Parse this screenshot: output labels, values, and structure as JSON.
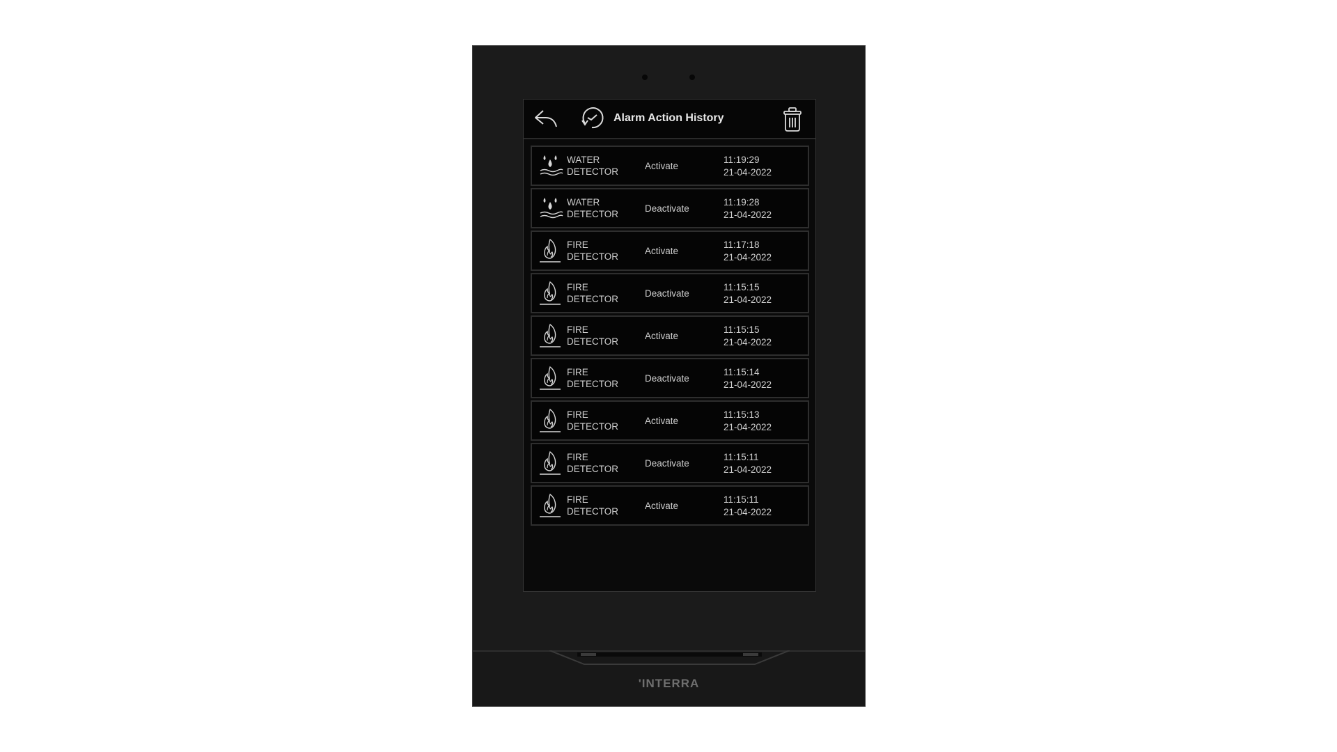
{
  "device": {
    "brand_logo": "'INTERRA"
  },
  "header": {
    "back_icon": "back-arrow-icon",
    "history_icon": "history-clock-icon",
    "title": "Alarm Action History",
    "delete_icon": "trash-icon"
  },
  "rows": [
    {
      "icon": "water-detector-icon",
      "device": "WATER DETECTOR",
      "action": "Activate",
      "time": "11:19:29",
      "date": "21-04-2022"
    },
    {
      "icon": "water-detector-icon",
      "device": "WATER DETECTOR",
      "action": "Deactivate",
      "time": "11:19:28",
      "date": "21-04-2022"
    },
    {
      "icon": "fire-detector-icon",
      "device": "FIRE DETECTOR",
      "action": "Activate",
      "time": "11:17:18",
      "date": "21-04-2022"
    },
    {
      "icon": "fire-detector-icon",
      "device": "FIRE DETECTOR",
      "action": "Deactivate",
      "time": "11:15:15",
      "date": "21-04-2022"
    },
    {
      "icon": "fire-detector-icon",
      "device": "FIRE DETECTOR",
      "action": "Activate",
      "time": "11:15:15",
      "date": "21-04-2022"
    },
    {
      "icon": "fire-detector-icon",
      "device": "FIRE DETECTOR",
      "action": "Deactivate",
      "time": "11:15:14",
      "date": "21-04-2022"
    },
    {
      "icon": "fire-detector-icon",
      "device": "FIRE DETECTOR",
      "action": "Activate",
      "time": "11:15:13",
      "date": "21-04-2022"
    },
    {
      "icon": "fire-detector-icon",
      "device": "FIRE DETECTOR",
      "action": "Deactivate",
      "time": "11:15:11",
      "date": "21-04-2022"
    },
    {
      "icon": "fire-detector-icon",
      "device": "FIRE DETECTOR",
      "action": "Activate",
      "time": "11:15:11",
      "date": "21-04-2022"
    }
  ]
}
